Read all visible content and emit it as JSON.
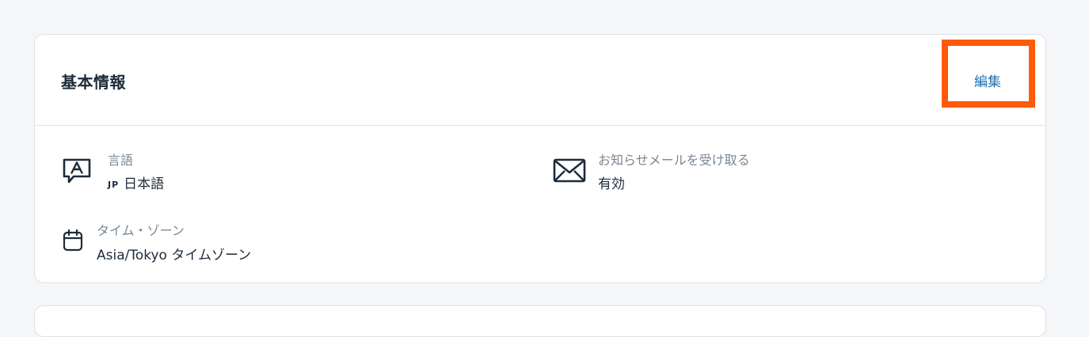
{
  "card": {
    "title": "基本情報",
    "edit_label": "編集"
  },
  "fields": {
    "language": {
      "label": "言語",
      "code": "JP",
      "value": "日本語",
      "icon": "chat-letter-a-icon"
    },
    "notification": {
      "label": "お知らせメールを受け取る",
      "value": "有効",
      "icon": "envelope-icon"
    },
    "timezone": {
      "label": "タイム・ゾーン",
      "value": "Asia/Tokyo タイムゾーン",
      "icon": "calendar-icon"
    }
  },
  "colors": {
    "highlight": "#ff5a0a",
    "link": "#1f6fb2"
  }
}
